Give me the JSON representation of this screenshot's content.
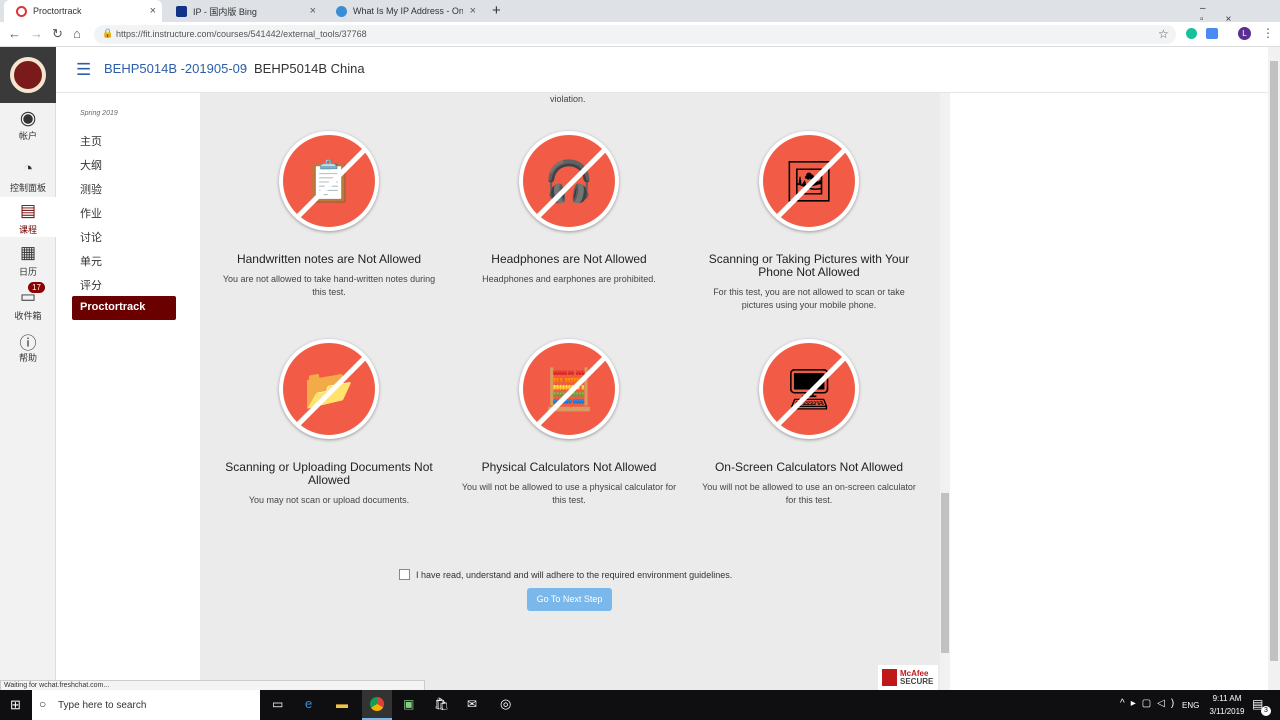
{
  "browser": {
    "tabs": [
      {
        "title": "Proctortrack",
        "active": true
      },
      {
        "title": "IP - 国内版 Bing"
      },
      {
        "title": "What Is My IP Address - Online P"
      }
    ],
    "url": "https://fit.instructure.com/courses/541442/external_tools/37768",
    "status": "Waiting for wchat.freshchat.com..."
  },
  "global_nav": {
    "items": [
      {
        "label": "帐户",
        "icon": "avatar-icon"
      },
      {
        "label": "控制面板",
        "icon": "dashboard-icon"
      },
      {
        "label": "课程",
        "icon": "book-icon",
        "selected": true
      },
      {
        "label": "日历",
        "icon": "calendar-icon"
      },
      {
        "label": "收件箱",
        "icon": "inbox-icon",
        "badge": "17"
      },
      {
        "label": "帮助",
        "icon": "help-icon"
      }
    ]
  },
  "breadcrumb": {
    "course": "BEHP5014B -201905-09",
    "current": "BEHP5014B China"
  },
  "course_nav": {
    "term": "Spring 2019",
    "items": [
      "主页",
      "大纲",
      "测验",
      "作业",
      "讨论",
      "单元",
      "评分"
    ],
    "active": "Proctortrack"
  },
  "content": {
    "top_text": "violation.",
    "rules": [
      {
        "title": "Handwritten notes are Not Allowed",
        "desc": "You are not allowed to take hand-written notes during this test.",
        "icon": "notepad-icon"
      },
      {
        "title": "Headphones are Not Allowed",
        "desc": "Headphones and earphones are prohibited.",
        "icon": "headphones-icon"
      },
      {
        "title": "Scanning or Taking Pictures with Your Phone Not Allowed",
        "desc": "For this test, you are not allowed to scan or take pictures using your mobile phone.",
        "icon": "picture-icon"
      },
      {
        "title": "Scanning or Uploading Documents Not Allowed",
        "desc": "You may not scan or upload documents.",
        "icon": "upload-document-icon"
      },
      {
        "title": "Physical Calculators Not Allowed",
        "desc": "You will not be allowed to use a physical calculator for this test.",
        "icon": "calculator-icon"
      },
      {
        "title": "On-Screen Calculators Not Allowed",
        "desc": "You will not be allowed to use an on-screen calculator for this test.",
        "icon": "onscreen-calculator-icon"
      }
    ],
    "agree_label": "I have read, understand and will adhere to the required environment guidelines.",
    "next_button": "Go To Next Step",
    "badge": {
      "line1": "McAfee",
      "line2": "SECURE"
    }
  },
  "taskbar": {
    "search_placeholder": "Type here to search",
    "lang": "ENG",
    "time": "9:11 AM",
    "date": "3/11/2019",
    "notifications": "3"
  },
  "colors": {
    "accent": "#6b0000",
    "prohibit": "#f25b46",
    "link": "#2d5fa6",
    "button": "#7ab7ea"
  }
}
